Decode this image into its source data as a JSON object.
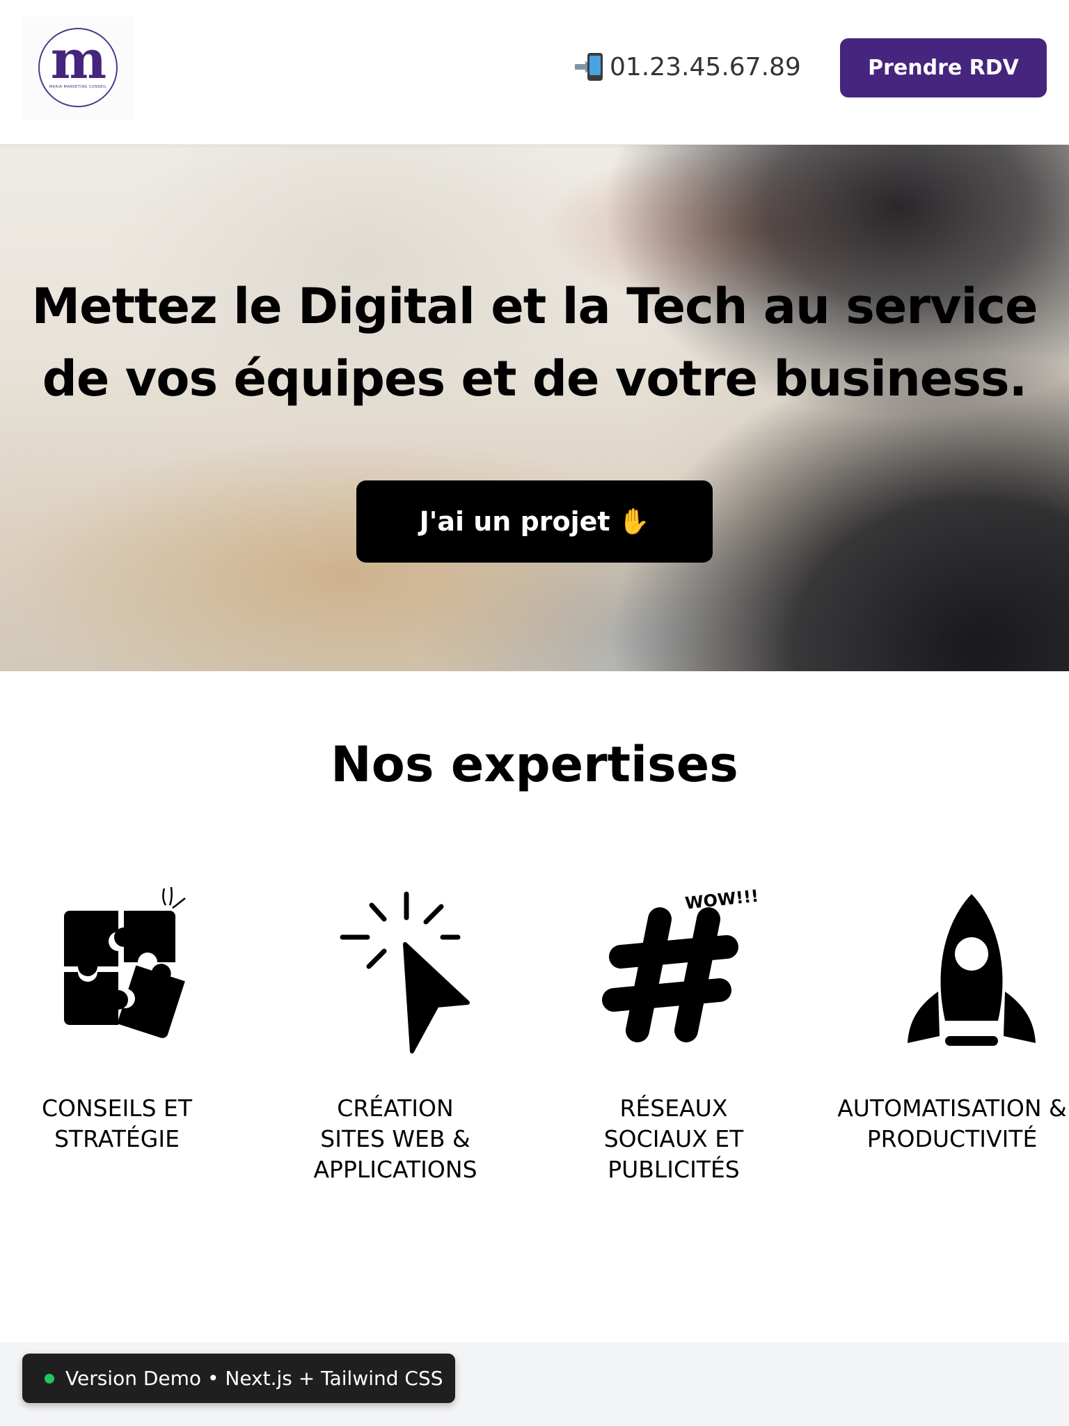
{
  "header": {
    "logo": {
      "letter": "m",
      "tagline": "MARIA MARKETING CONSEIL"
    },
    "phone": {
      "icon": "mobile-phone-arrow-icon",
      "number": "01.23.45.67.89"
    },
    "cta_label": "Prendre RDV"
  },
  "hero": {
    "title_line1": "Mettez le Digital et la Tech au service",
    "title_line2": "de vos équipes et de votre business.",
    "cta_label": "J'ai un projet",
    "cta_icon": "raised-hand-icon"
  },
  "expertises": {
    "title": "Nos expertises",
    "items": [
      {
        "icon": "puzzle-icon",
        "label": "CONSEILS ET STRATÉGIE"
      },
      {
        "icon": "cursor-click-icon",
        "label": "CRÉATION SITES WEB & APPLICATIONS",
        "label_line1": "CRÉATION",
        "label_line2": "SITES WEB &",
        "label_line3": "APPLICATIONS"
      },
      {
        "icon": "hashtag-icon",
        "label": "RÉSEAUX SOCIAUX ET PUBLICITÉS",
        "label_line1": "RÉSEAUX",
        "label_line2": "SOCIAUX ET",
        "label_line3": "PUBLICITÉS",
        "icon_text": "WOW!!!"
      },
      {
        "icon": "rocket-icon",
        "label": "AUTOMATISATION & PRODUCTIVITÉ"
      }
    ]
  },
  "demo_badge": {
    "text": "Version Demo • Next.js + Tailwind CSS",
    "status_color": "#22c55e"
  },
  "colors": {
    "brand_purple": "#45257e",
    "hero_button": "#000000",
    "badge_bg": "#1f1f1f"
  }
}
